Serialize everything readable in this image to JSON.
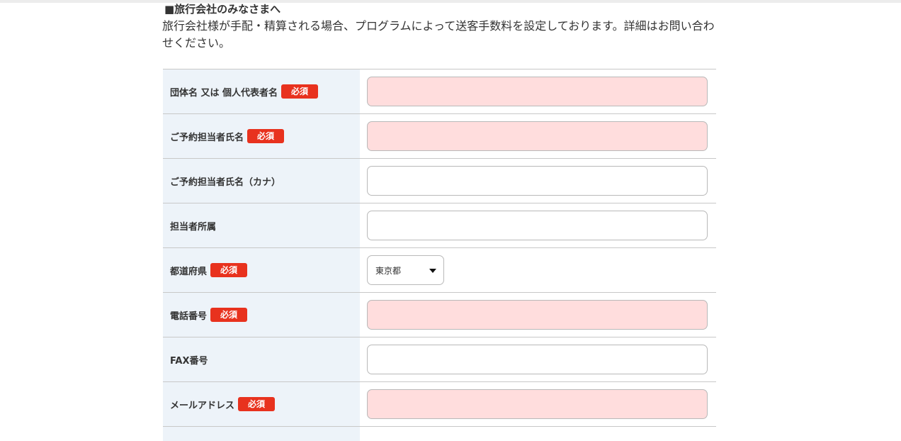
{
  "section": {
    "heading": "■旅行会社のみなさまへ",
    "intro": "旅行会社様が手配・精算される場合、プログラムによって送客手数料を設定しております。詳細はお問い合わせください。"
  },
  "form": {
    "required_badge": "必須",
    "fields": [
      {
        "label": "団体名 又は 個人代表者名",
        "required": true,
        "type": "text",
        "value": ""
      },
      {
        "label": "ご予約担当者氏名",
        "required": true,
        "type": "text",
        "value": ""
      },
      {
        "label": "ご予約担当者氏名（カナ）",
        "required": false,
        "type": "text",
        "value": ""
      },
      {
        "label": "担当者所属",
        "required": false,
        "type": "text",
        "value": ""
      },
      {
        "label": "都道府県",
        "required": true,
        "type": "select",
        "value": "東京都"
      },
      {
        "label": "電話番号",
        "required": true,
        "type": "text",
        "value": ""
      },
      {
        "label": "FAX番号",
        "required": false,
        "type": "text",
        "value": ""
      },
      {
        "label": "メールアドレス",
        "required": true,
        "type": "text",
        "value": ""
      }
    ]
  },
  "colors": {
    "required_badge_bg": "#e8321e",
    "required_input_bg": "#ffdddd",
    "label_cell_bg": "#edf3f9"
  },
  "icons": {
    "select_arrow": "caret-down-icon"
  }
}
